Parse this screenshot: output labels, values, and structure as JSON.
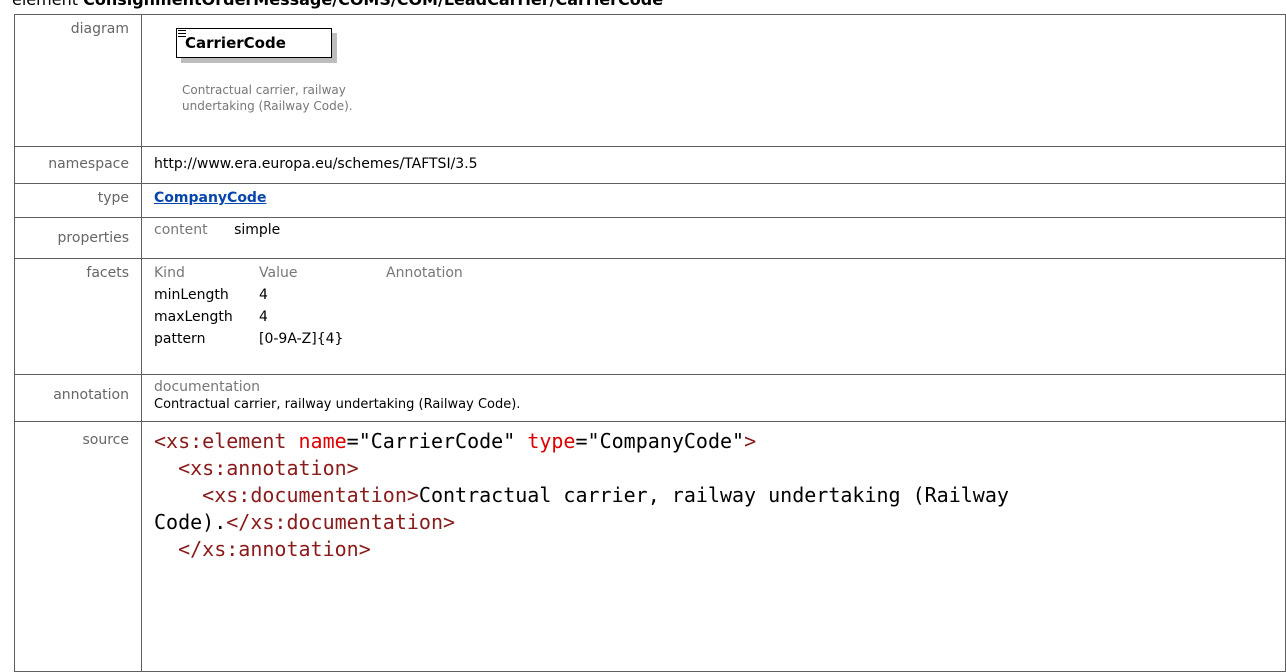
{
  "heading": {
    "prefix": "element",
    "path": "ConsignmentOrderMessage/COMS/COM/LeadCarrier/CarrierCode"
  },
  "labels": {
    "diagram": "diagram",
    "namespace": "namespace",
    "type": "type",
    "properties": "properties",
    "facets": "facets",
    "annotation": "annotation",
    "source": "source"
  },
  "diagram": {
    "box_label": "CarrierCode",
    "doc": "Contractual carrier, railway undertaking (Railway Code)."
  },
  "namespace": "http://www.era.europa.eu/schemes/TAFTSI/3.5",
  "type": {
    "link": "CompanyCode"
  },
  "properties": {
    "key": "content",
    "value": "simple"
  },
  "facets": {
    "headers": [
      "Kind",
      "Value",
      "Annotation"
    ],
    "rows": [
      {
        "kind": "minLength",
        "value": "4",
        "annotation": ""
      },
      {
        "kind": "maxLength",
        "value": "4",
        "annotation": ""
      },
      {
        "kind": "pattern",
        "value": "[0-9A-Z]{4}",
        "annotation": ""
      }
    ]
  },
  "annotation": {
    "head": "documentation",
    "text": "Contractual carrier, railway undertaking (Railway Code)."
  },
  "source": {
    "l1_tag_open": "<xs:element",
    "l1_attr1": "name",
    "l1_val1": "\"CarrierCode\"",
    "l1_attr2": "type",
    "l1_val2": "\"CompanyCode\"",
    "l1_close": ">",
    "l2_tag": "<xs:annotation>",
    "l3_tag_open": "<xs:documentation>",
    "l3_text": "Contractual carrier, railway undertaking (Railway",
    "l4_text": "Code).",
    "l4_tag_close": "</xs:documentation>",
    "l5_tag": "</xs:annotation>"
  }
}
